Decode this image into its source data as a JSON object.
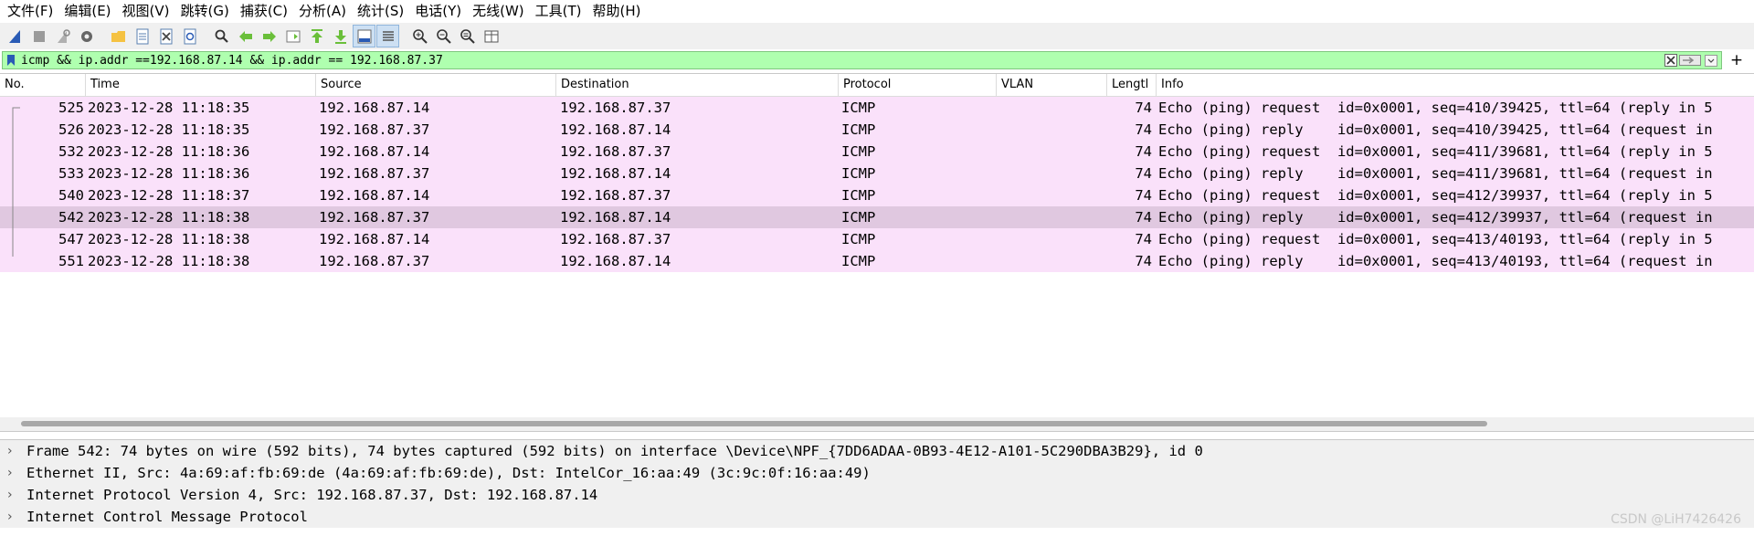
{
  "menu": [
    "文件(F)",
    "编辑(E)",
    "视图(V)",
    "跳转(G)",
    "捕获(C)",
    "分析(A)",
    "统计(S)",
    "电话(Y)",
    "无线(W)",
    "工具(T)",
    "帮助(H)"
  ],
  "toolbar": {
    "icons": [
      "shark-fin-start-icon",
      "stop-capture-icon",
      "restart-capture-icon",
      "capture-options-icon",
      "open-file-icon",
      "save-file-icon",
      "close-file-icon",
      "reload-file-icon",
      "find-packet-icon",
      "go-back-icon",
      "go-forward-icon",
      "go-to-packet-icon",
      "go-first-icon",
      "go-last-icon",
      "autoscroll-icon",
      "colorize-icon",
      "zoom-in-icon",
      "zoom-out-icon",
      "zoom-normal-icon",
      "resize-columns-icon"
    ]
  },
  "filter": {
    "text": "icmp && ip.addr ==192.168.87.14 && ip.addr == 192.168.87.37",
    "bg_color": "#afffaf"
  },
  "columns": [
    "No.",
    "Time",
    "Source",
    "Destination",
    "Protocol",
    "VLAN",
    "Lengtl",
    "Info"
  ],
  "packets": [
    {
      "no": "525",
      "time": "2023-12-28 11:18:35",
      "src": "192.168.87.14",
      "dst": "192.168.87.37",
      "proto": "ICMP",
      "len": "74",
      "info": "Echo (ping) request  id=0x0001, seq=410/39425, ttl=64 (reply in 5"
    },
    {
      "no": "526",
      "time": "2023-12-28 11:18:35",
      "src": "192.168.87.37",
      "dst": "192.168.87.14",
      "proto": "ICMP",
      "len": "74",
      "info": "Echo (ping) reply    id=0x0001, seq=410/39425, ttl=64 (request in"
    },
    {
      "no": "532",
      "time": "2023-12-28 11:18:36",
      "src": "192.168.87.14",
      "dst": "192.168.87.37",
      "proto": "ICMP",
      "len": "74",
      "info": "Echo (ping) request  id=0x0001, seq=411/39681, ttl=64 (reply in 5"
    },
    {
      "no": "533",
      "time": "2023-12-28 11:18:36",
      "src": "192.168.87.37",
      "dst": "192.168.87.14",
      "proto": "ICMP",
      "len": "74",
      "info": "Echo (ping) reply    id=0x0001, seq=411/39681, ttl=64 (request in"
    },
    {
      "no": "540",
      "time": "2023-12-28 11:18:37",
      "src": "192.168.87.14",
      "dst": "192.168.87.37",
      "proto": "ICMP",
      "len": "74",
      "info": "Echo (ping) request  id=0x0001, seq=412/39937, ttl=64 (reply in 5"
    },
    {
      "no": "542",
      "time": "2023-12-28 11:18:38",
      "src": "192.168.87.37",
      "dst": "192.168.87.14",
      "proto": "ICMP",
      "len": "74",
      "info": "Echo (ping) reply    id=0x0001, seq=412/39937, ttl=64 (request in",
      "selected": true
    },
    {
      "no": "547",
      "time": "2023-12-28 11:18:38",
      "src": "192.168.87.14",
      "dst": "192.168.87.37",
      "proto": "ICMP",
      "len": "74",
      "info": "Echo (ping) request  id=0x0001, seq=413/40193, ttl=64 (reply in 5"
    },
    {
      "no": "551",
      "time": "2023-12-28 11:18:38",
      "src": "192.168.87.37",
      "dst": "192.168.87.14",
      "proto": "ICMP",
      "len": "74",
      "info": "Echo (ping) reply    id=0x0001, seq=413/40193, ttl=64 (request in"
    }
  ],
  "row_colors": {
    "normal": "#fae1fa",
    "selected": "#e0c8e0"
  },
  "details": [
    "Frame 542: 74 bytes on wire (592 bits), 74 bytes captured (592 bits) on interface \\Device\\NPF_{7DD6ADAA-0B93-4E12-A101-5C290DBA3B29}, id 0",
    "Ethernet II, Src: 4a:69:af:fb:69:de (4a:69:af:fb:69:de), Dst: IntelCor_16:aa:49 (3c:9c:0f:16:aa:49)",
    "Internet Protocol Version 4, Src: 192.168.87.37, Dst: 192.168.87.14",
    "Internet Control Message Protocol"
  ],
  "watermark": "CSDN @LiH7426426"
}
